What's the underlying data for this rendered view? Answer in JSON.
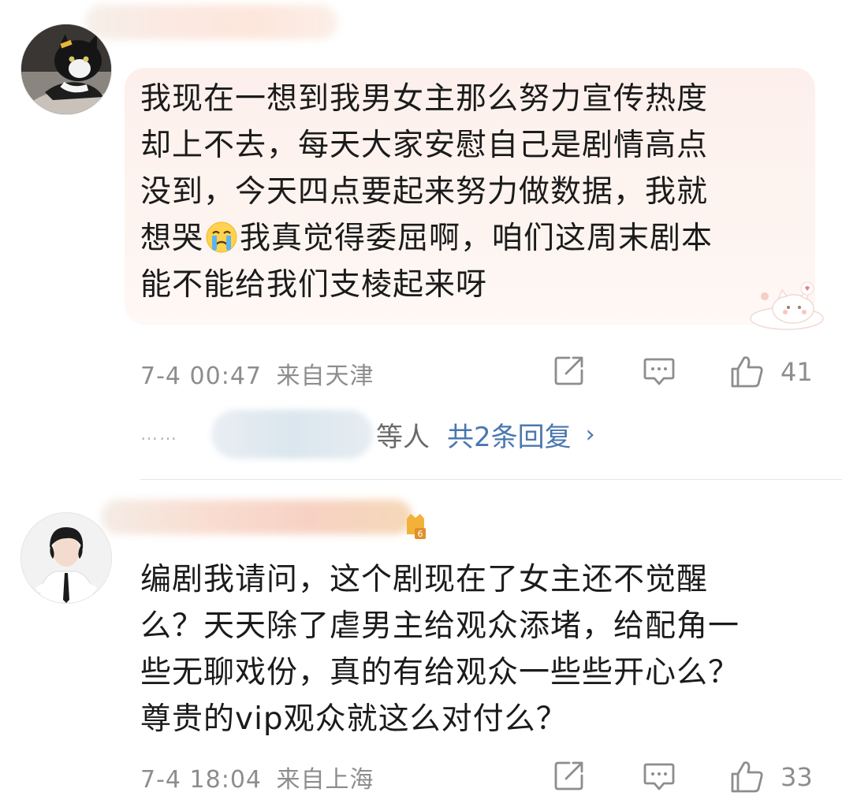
{
  "comments": [
    {
      "text_line1": "我现在一想到我男女主那么努力宣传热度",
      "text_line2": "却上不去，每天大家安慰自己是剧情高点",
      "text_line3": "没到，今天四点要起来努力做数据，我就",
      "text_line4a": "想哭",
      "text_line4b": "我真觉得委屈啊，咱们这周末剧本",
      "text_line5": "能不能给我们支棱起来呀",
      "emoji": "crying-face-emoji",
      "time": "7-4 00:47",
      "location": "来自天津",
      "likes": "41",
      "replies_dots": "……",
      "replies_suffix": "等人",
      "replies_total": "共2条回复",
      "replies_chevron": "›"
    },
    {
      "text_line1": "编剧我请问，这个剧现在了女主还不觉醒",
      "text_line2": "么？天天除了虐男主给观众添堵，给配角一",
      "text_line3": "些无聊戏份，真的有给观众一些些开心么？",
      "text_line4": "尊贵的vip观众就这么对付么？",
      "time": "7-4 18:04",
      "location": "来自上海",
      "likes": "33"
    }
  ],
  "colors": {
    "link_blue": "#4a77b0",
    "meta_gray": "#8d8d8d",
    "card_pink": "#fdf0ec"
  }
}
